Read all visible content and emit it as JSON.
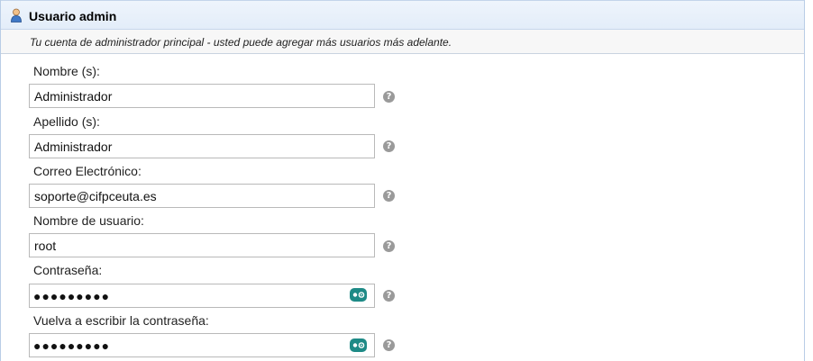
{
  "section": {
    "icon": "user-icon",
    "title": "Usuario admin",
    "description": "Tu cuenta de administrador principal - usted puede agregar más usuarios más adelante."
  },
  "fields": {
    "first_name": {
      "label": "Nombre (s):",
      "value": "Administrador",
      "help": "?"
    },
    "last_name": {
      "label": "Apellido (s):",
      "value": "Administrador",
      "help": "?"
    },
    "email": {
      "label": "Correo Electrónico:",
      "value": "soporte@cifpceuta.es",
      "help": "?"
    },
    "username": {
      "label": "Nombre de usuario:",
      "value": "root",
      "help": "?"
    },
    "password": {
      "label": "Contraseña:",
      "value": "●●●●●●●●●",
      "icon": "show-password-icon",
      "help": "?"
    },
    "password_confirm": {
      "label": "Vuelva a escribir la contraseña:",
      "value": "●●●●●●●●●",
      "icon": "show-password-icon",
      "help": "?"
    }
  },
  "colors": {
    "header_bg": "#e6eefa",
    "border": "#b9cde6",
    "help_icon": "#9a9a9a",
    "eye_icon": "#1e8a86"
  }
}
